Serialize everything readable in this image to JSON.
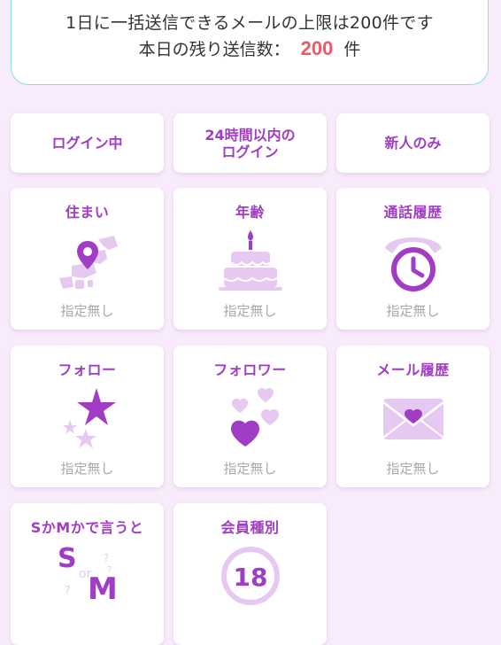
{
  "info": {
    "limit_text": "1日に一括送信できるメールの上限は200件です",
    "remaining_label": "本日の残り送信数：",
    "remaining_count": "200",
    "remaining_unit": "件"
  },
  "filters": [
    {
      "label": "ログイン中"
    },
    {
      "label": "24時間以内の\nログイン"
    },
    {
      "label": "新人のみ"
    }
  ],
  "categories": [
    {
      "title": "住まい",
      "value": "指定無し",
      "icon": "japan-map-pin-icon"
    },
    {
      "title": "年齢",
      "value": "指定無し",
      "icon": "cake-icon"
    },
    {
      "title": "通話履歴",
      "value": "指定無し",
      "icon": "phone-clock-icon"
    },
    {
      "title": "フォロー",
      "value": "指定無し",
      "icon": "stars-icon"
    },
    {
      "title": "フォロワー",
      "value": "指定無し",
      "icon": "hearts-icon"
    },
    {
      "title": "メール履歴",
      "value": "指定無し",
      "icon": "envelope-heart-icon"
    },
    {
      "title": "SかMかで言うと",
      "value": "",
      "icon": "s-or-m-icon"
    },
    {
      "title": "会員種別",
      "value": "",
      "icon": "age-18-icon"
    }
  ],
  "icon_text": {
    "s_letter": "S",
    "or_text": "or",
    "m_letter": "M",
    "age_number": "18"
  },
  "colors": {
    "accent": "#a13cc4",
    "icon_light": "#e6c9f0",
    "count": "#ef5868",
    "info_border": "#8cd9ea",
    "background": "#f8ebfb"
  }
}
